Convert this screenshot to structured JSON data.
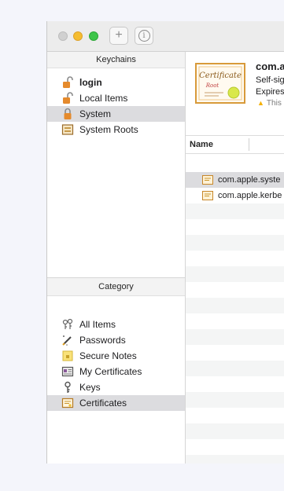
{
  "toolbar": {
    "add_label": "+",
    "info_label": "i"
  },
  "sidebar": {
    "keychains_header": "Keychains",
    "keychains": [
      {
        "label": "login",
        "icon": "lock-open-icon",
        "bold": true
      },
      {
        "label": "Local Items",
        "icon": "lock-open-icon",
        "bold": false
      },
      {
        "label": "System",
        "icon": "lock-closed-icon",
        "bold": false,
        "selected": true
      },
      {
        "label": "System Roots",
        "icon": "certificate-cabinet-icon",
        "bold": false
      }
    ],
    "category_header": "Category",
    "categories": [
      {
        "label": "All Items",
        "icon": "all-items-icon"
      },
      {
        "label": "Passwords",
        "icon": "pen-icon"
      },
      {
        "label": "Secure Notes",
        "icon": "note-icon"
      },
      {
        "label": "My Certificates",
        "icon": "id-card-icon"
      },
      {
        "label": "Keys",
        "icon": "key-icon"
      },
      {
        "label": "Certificates",
        "icon": "certificate-icon",
        "selected": true
      }
    ]
  },
  "detail": {
    "name": "com.a",
    "line1": "Self-sig",
    "line2": "Expires",
    "line3": "This",
    "cert_badge_text": "Certificate",
    "cert_badge_sub": "Root"
  },
  "list": {
    "column_name": "Name",
    "rows": [
      {
        "label": "com.apple.syste"
      },
      {
        "label": "com.apple.kerbe"
      }
    ]
  },
  "colors": {
    "selection": "#dcdcdf",
    "accent_gold": "#e8b84a",
    "warning": "#f5b000"
  }
}
